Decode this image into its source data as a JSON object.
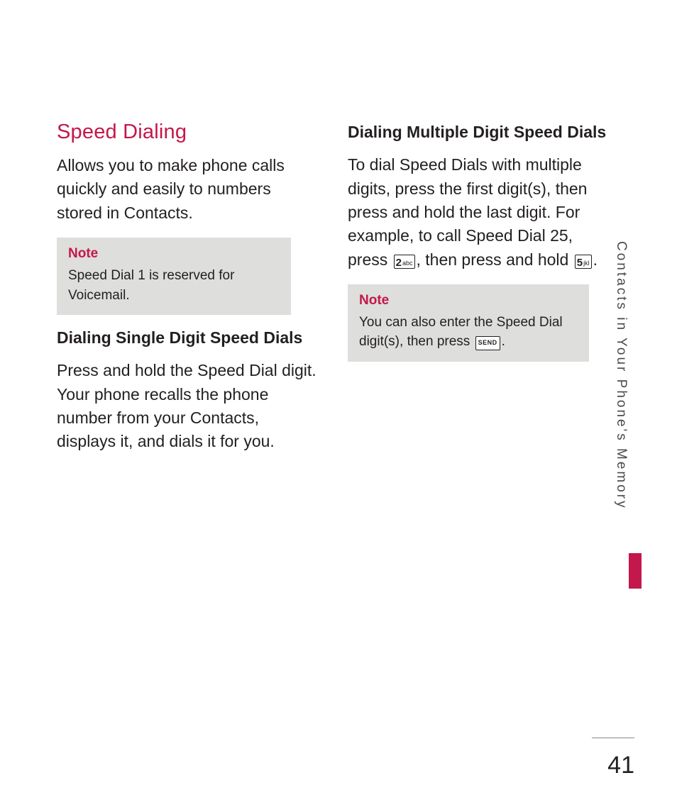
{
  "left": {
    "title": "Speed Dialing",
    "intro": "Allows you to make phone calls quickly and easily to numbers stored in Contacts.",
    "note_title": "Note",
    "note_text": "Speed Dial 1 is reserved for Voicemail.",
    "sub": "Dialing Single Digit Speed Dials",
    "body": "Press and hold the Speed Dial digit. Your phone recalls the phone number from your Contacts, displays it, and dials it for you."
  },
  "right": {
    "sub": "Dialing Multiple Digit Speed Dials",
    "body_a": "To dial Speed Dials with multiple digits, press the first digit(s), then press and hold the last digit. For example, to call Speed Dial 25, press ",
    "body_b": ", then press and hold ",
    "body_c": ".",
    "key2_big": "2",
    "key2_small": "abc",
    "key5_big": "5",
    "key5_small": "jkl",
    "note_title": "Note",
    "note_text_a": "You can also enter the Speed Dial digit(s), then press ",
    "note_text_b": ".",
    "key_send": "SEND"
  },
  "side": {
    "label": "Contacts in Your Phone's Memory"
  },
  "page": "41"
}
